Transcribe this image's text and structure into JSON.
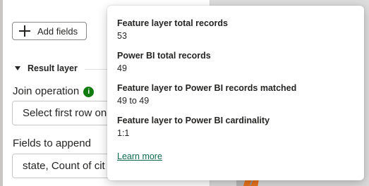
{
  "pane": {
    "add_fields_label": "Add fields",
    "section_title": "Result layer",
    "join_operation_label": "Join operation",
    "join_operation_info_icon": "i",
    "join_operation_value": "Select first row on",
    "fields_to_append_label": "Fields to append",
    "fields_to_append_value": "state, Count of cit"
  },
  "popover": {
    "stats": [
      {
        "label": "Feature layer total records",
        "value": "53"
      },
      {
        "label": "Power BI total records",
        "value": "49"
      },
      {
        "label": "Feature layer to Power BI records matched",
        "value": "49 to 49"
      },
      {
        "label": "Feature layer to Power BI cardinality",
        "value": "1:1"
      }
    ],
    "learn_more": "Learn more"
  },
  "colors": {
    "info_badge": "#107c10",
    "link": "#0f6b4e",
    "map_feature": "#e8741c"
  }
}
